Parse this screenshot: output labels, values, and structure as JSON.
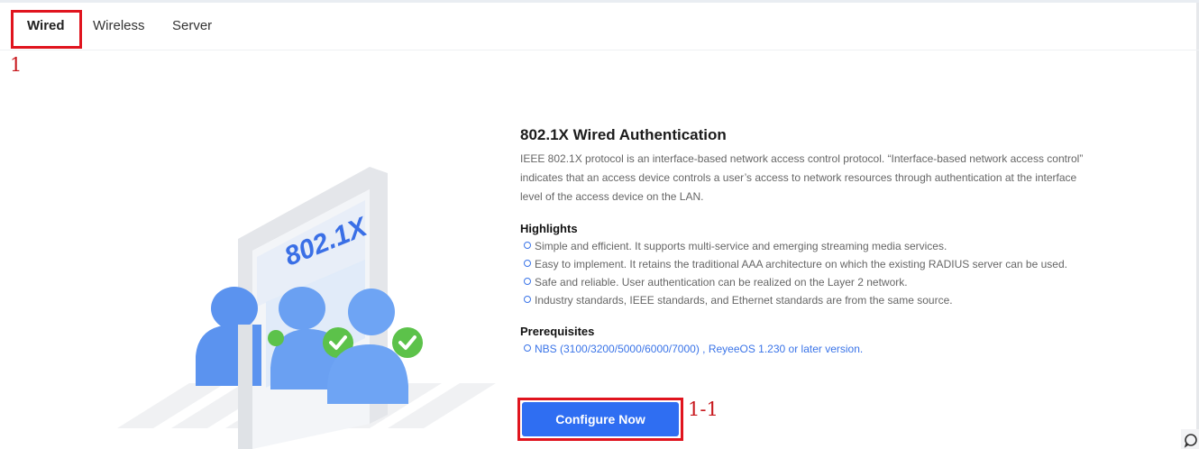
{
  "tabs": [
    {
      "label": "Wired",
      "active": true
    },
    {
      "label": "Wireless",
      "active": false
    },
    {
      "label": "Server",
      "active": false
    }
  ],
  "annotations": {
    "tab_label": "1",
    "button_label": "1-1",
    "color": "#e0141e"
  },
  "illustration": {
    "gate_text": "802.1X"
  },
  "main": {
    "title": "802.1X Wired Authentication",
    "description": "IEEE 802.1X protocol is an interface-based network access control protocol. “Interface-based network access control” indicates that an access device controls a user’s access to network resources through authentication at the interface level of the access device on the LAN.",
    "highlights_title": "Highlights",
    "highlights": [
      "Simple and efficient. It supports multi-service and emerging streaming media services.",
      "Easy to implement. It retains the traditional AAA architecture on which the existing RADIUS server can be used.",
      "Safe and reliable. User authentication can be realized on the Layer 2 network.",
      "Industry standards, IEEE standards, and Ethernet standards are from the same source."
    ],
    "prerequisites_title": "Prerequisites",
    "prerequisites": [
      "NBS (3100/3200/5000/6000/7000) ,  ReyeeOS 1.230 or later version."
    ],
    "configure_button": "Configure Now"
  },
  "colors": {
    "accent": "#2f6ef2",
    "link": "#3a74e8",
    "check": "#5cc24a"
  }
}
